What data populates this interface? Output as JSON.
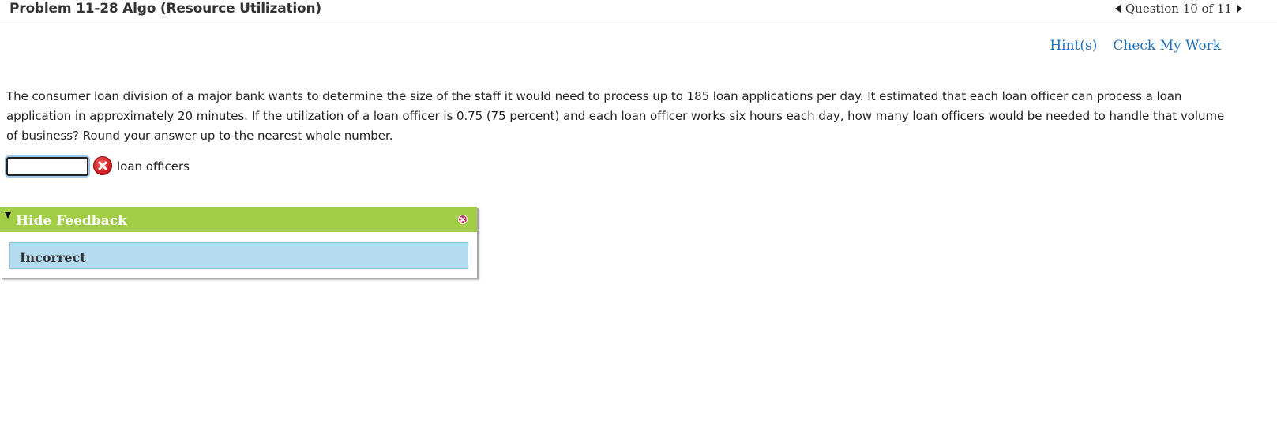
{
  "header": {
    "title": "Problem 11-28 Algo (Resource Utilization)",
    "question_nav": "Question 10 of 11"
  },
  "links": {
    "hints": "Hint(s)",
    "check_my_work": "Check My Work"
  },
  "question": {
    "text": "The consumer loan division of a major bank wants to determine the size of the staff it would need to process up to 185 loan applications per day. It estimated that each loan officer can process a loan application in approximately 20 minutes. If the utilization of a loan officer is 0.75 (75 percent) and each loan officer works six hours each day, how many loan officers would be needed to handle that volume of business? Round your answer up to the nearest whole number."
  },
  "answer": {
    "value": "",
    "unit_label": "loan officers"
  },
  "feedback": {
    "toggle_label": "Hide Feedback",
    "result": "Incorrect"
  },
  "icons": {
    "error": "error-x-icon",
    "prev": "triangle-left-icon",
    "next": "triangle-right-icon",
    "collapse": "triangle-down-icon",
    "close": "close-circle-icon"
  },
  "colors": {
    "feedback_header": "#a2cd46",
    "feedback_body": "#b4dcee",
    "link": "#1f6fb5",
    "error": "#d3232a"
  }
}
